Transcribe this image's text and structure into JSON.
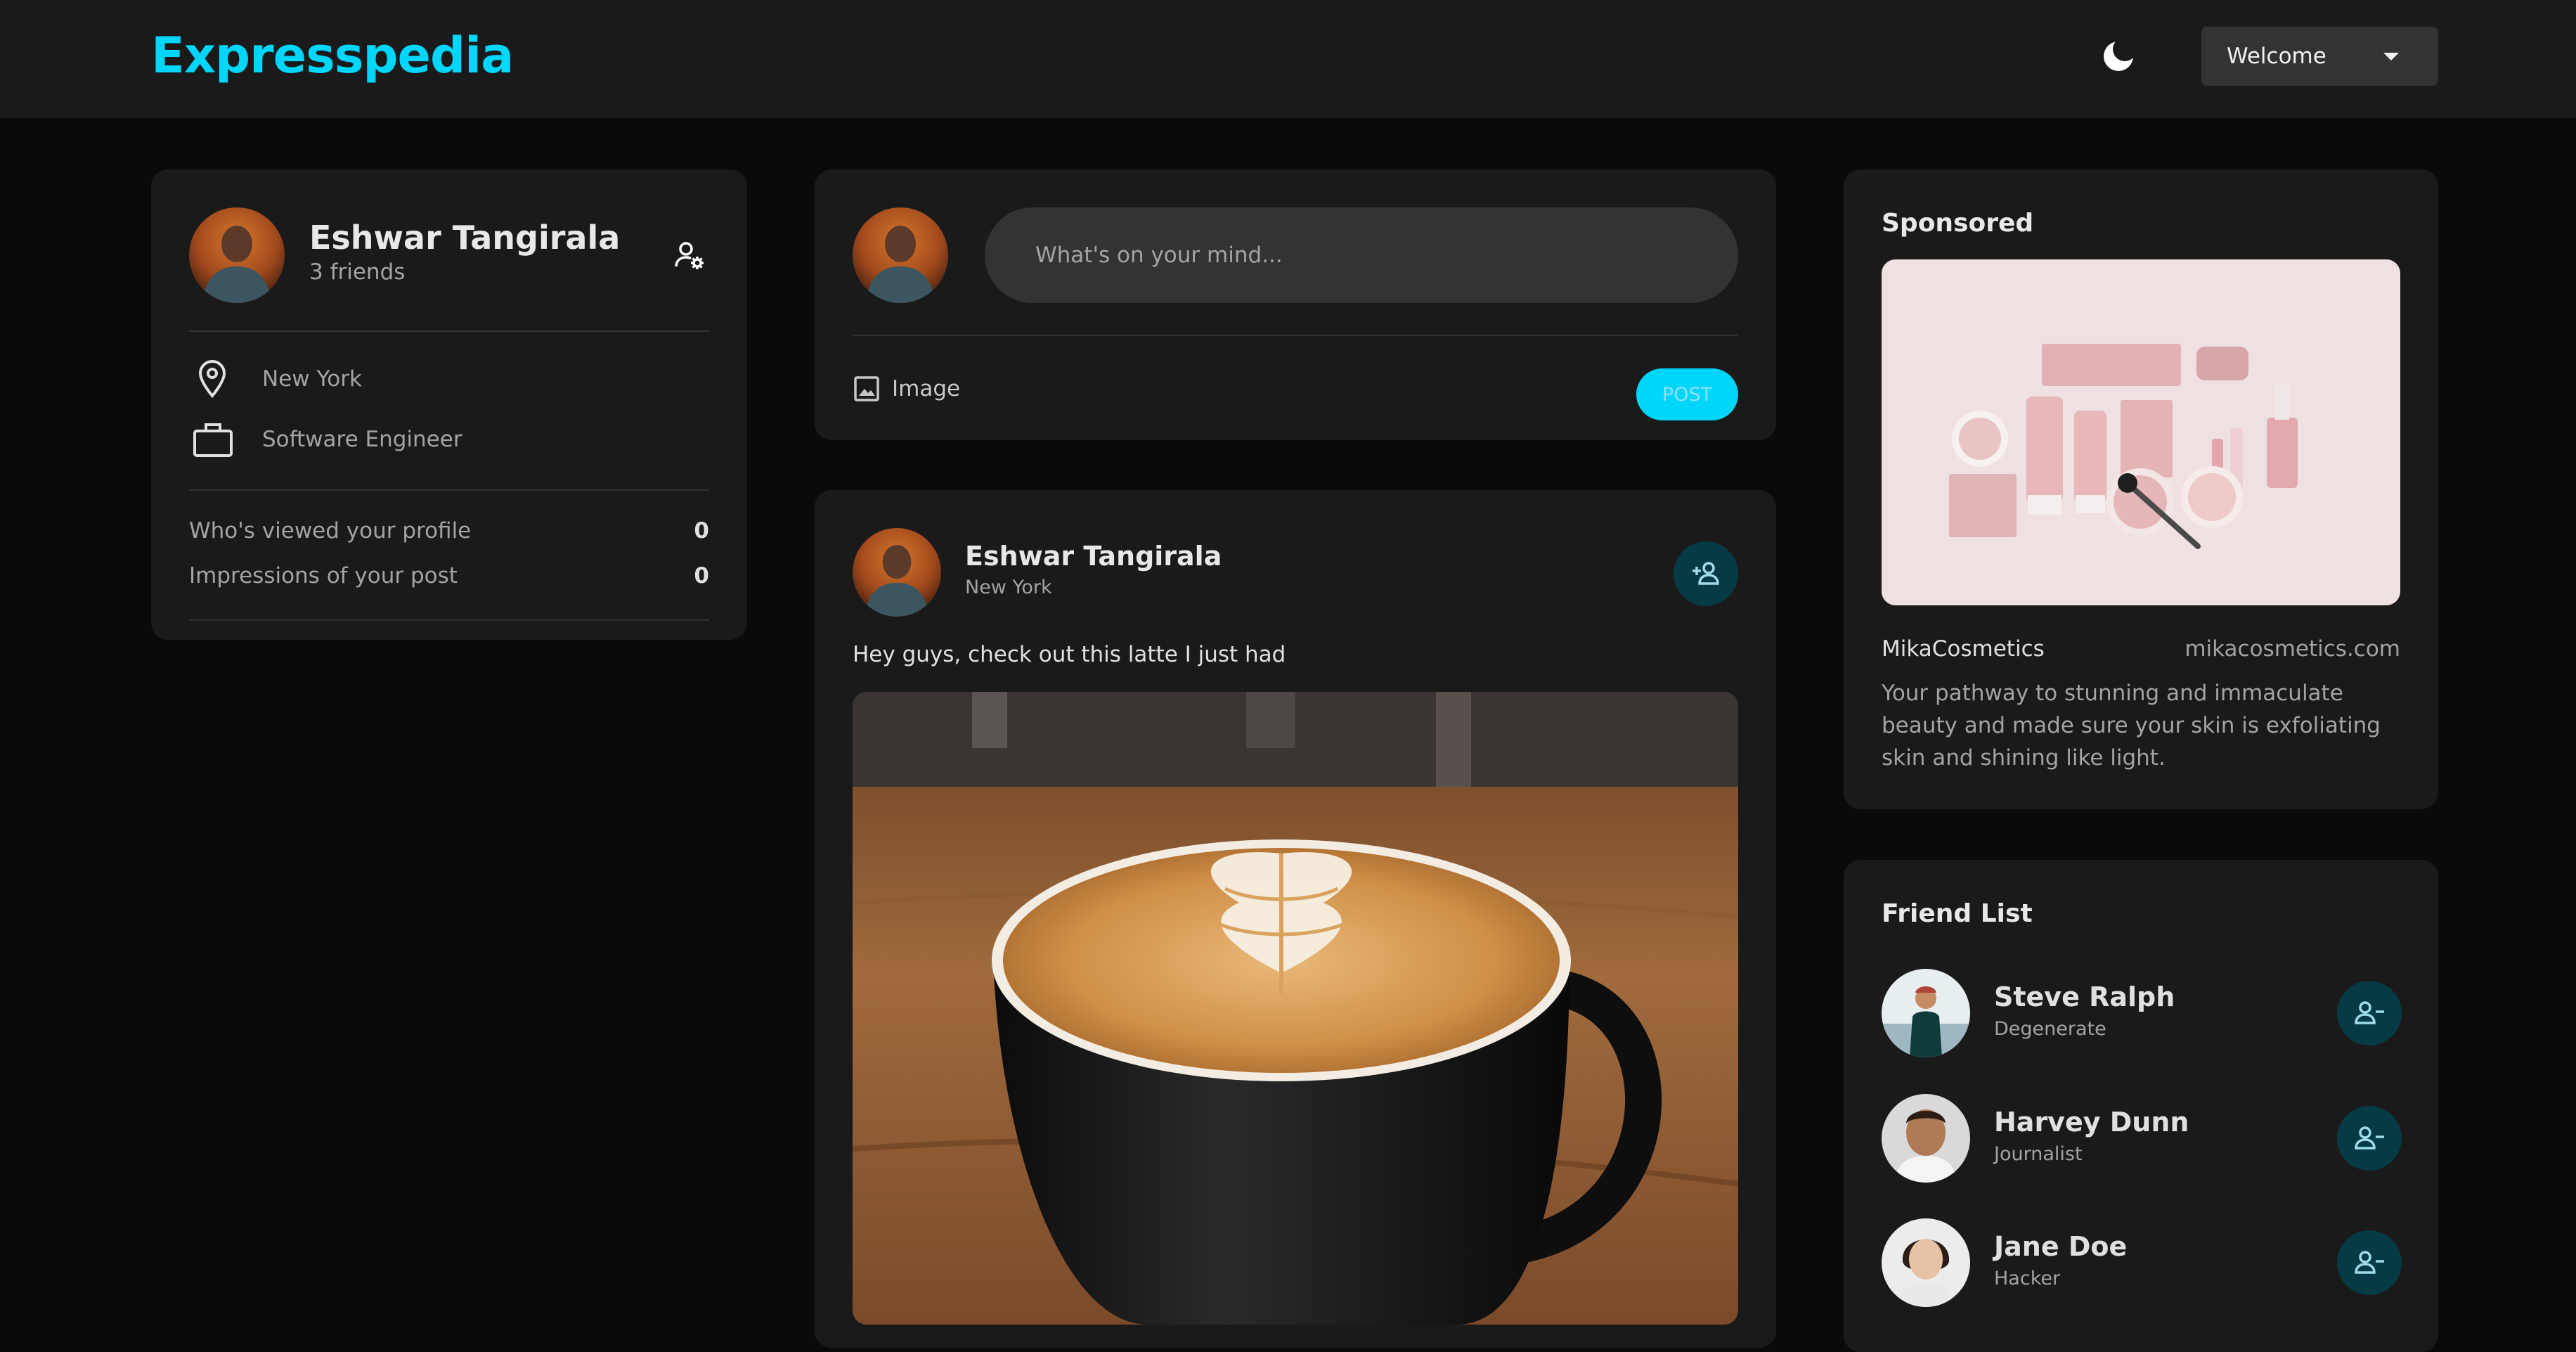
{
  "brand": "Expresspedia",
  "header": {
    "theme_icon": "moon-icon",
    "welcome_label": "Welcome"
  },
  "profile": {
    "name": "Eshwar Tangirala",
    "friends": "3 friends",
    "location": "New York",
    "occupation": "Software Engineer",
    "stats": [
      {
        "label": "Who's viewed your profile",
        "value": "0"
      },
      {
        "label": "Impressions of your post",
        "value": "0"
      }
    ]
  },
  "composer": {
    "placeholder": "What's on your mind...",
    "image_label": "Image",
    "post_label": "POST"
  },
  "post": {
    "author": "Eshwar Tangirala",
    "location": "New York",
    "text": "Hey guys, check out this latte I just had"
  },
  "sponsored": {
    "title": "Sponsored",
    "brand": "MikaCosmetics",
    "url": "mikacosmetics.com",
    "description": "Your pathway to stunning and immaculate beauty and made sure your skin is exfoliating skin and shining like light."
  },
  "friend_list": {
    "title": "Friend List",
    "friends": [
      {
        "name": "Steve Ralph",
        "role": "Degenerate"
      },
      {
        "name": "Harvey Dunn",
        "role": "Journalist"
      },
      {
        "name": "Jane Doe",
        "role": "Hacker"
      }
    ]
  },
  "colors": {
    "accent": "#00d5fa",
    "background": "#0a0a0a",
    "card": "#1a1a1a",
    "icon_button_bg": "#063a44"
  }
}
